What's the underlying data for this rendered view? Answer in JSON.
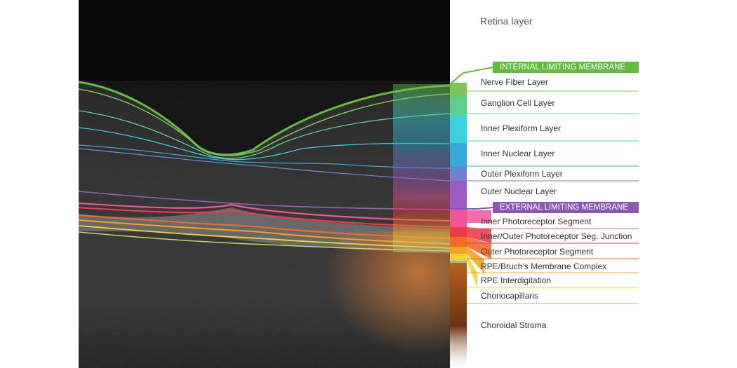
{
  "title": "Retina layer",
  "colors": {
    "ilm": "#5fbe3a",
    "elm": "#8a57b8",
    "nerve_fiber": "#7cc55a",
    "ganglion": "#5ccf8f",
    "inner_plexiform": "#3ad0de",
    "inner_nuclear": "#36a9d9",
    "outer_plexiform": "#6e82cf",
    "outer_nuclear": "#9a5cc4",
    "inner_photoreceptor": "#f2549a",
    "is_os_junction": "#ef3b49",
    "outer_photoreceptor": "#f36b2a",
    "rpe_bruch": "#f6a320",
    "rpe_interdigitation": "#f3d33a",
    "choriocapillaris": "#a8b88a",
    "choroidal_stroma": "#c96a1a"
  },
  "banners": {
    "ilm": "INTERNAL LIMITING MEMBRANE",
    "elm": "EXTERNAL LIMITING MEMBRANE"
  },
  "layers": [
    {
      "label": "Nerve Fiber Layer"
    },
    {
      "label": "Ganglion Cell Layer"
    },
    {
      "label": "Inner Plexiform Layer"
    },
    {
      "label": "Inner Nuclear Layer"
    },
    {
      "label": "Outer Plexiform Layer"
    },
    {
      "label": "Outer Nuclear Layer"
    },
    {
      "label": "Inner Photoreceptor Segment"
    },
    {
      "label": "Inner/Outer Photoreceptor Seg. Junction"
    },
    {
      "label": "Outer Photoreceptor Segment"
    },
    {
      "label": "RPE/Bruch’s Membrane Complex"
    },
    {
      "label": "RPE Interdigitation"
    },
    {
      "label": "Choriocapillaris"
    },
    {
      "label": "Choroidal Stroma"
    }
  ]
}
